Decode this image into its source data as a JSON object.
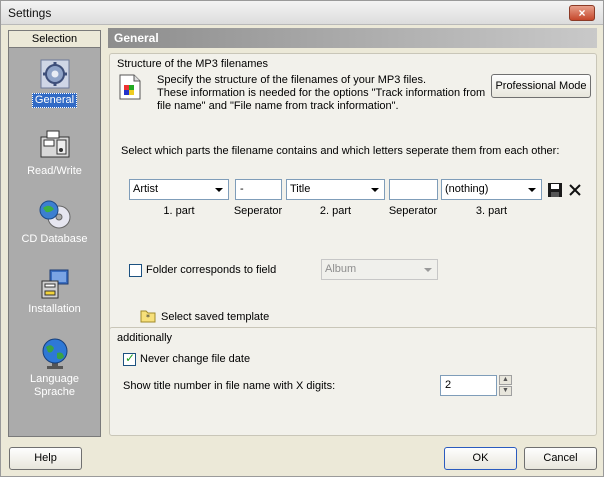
{
  "window": {
    "title": "Settings",
    "close_label": "×"
  },
  "sidebar": {
    "header": "Selection",
    "items": [
      {
        "label": "General",
        "icon": "gear-icon",
        "selected": true
      },
      {
        "label": "Read/Write",
        "icon": "read-write-icon"
      },
      {
        "label": "CD Database",
        "icon": "cd-icon"
      },
      {
        "label": "Installation",
        "icon": "installation-icon"
      },
      {
        "label": "Language",
        "label2": "Sprache",
        "icon": "globe-icon"
      }
    ]
  },
  "main": {
    "header": "General",
    "structure": {
      "title": "Structure of the MP3 filenames",
      "desc1": "Specify the structure of the filenames of your MP3 files.",
      "desc2": "These information is needed for the options \"Track information from",
      "desc3": "file name\" and \"File name from track information\".",
      "professional_button": "Professional Mode",
      "instruction": "Select which parts the filename contains and which letters seperate them from each other:",
      "part1_value": "Artist",
      "part1_caption": "1. part",
      "sep1_value": "-",
      "sep1_caption": "Seperator",
      "part2_value": "Title",
      "part2_caption": "2. part",
      "sep2_value": "",
      "sep2_caption": "Seperator",
      "part3_value": "(nothing)",
      "part3_caption": "3. part",
      "folder_label": "Folder corresponds to field",
      "folder_value": "Album",
      "template_label": "Select saved template"
    },
    "additionally": {
      "title": "additionally",
      "never_change_label": "Never change file date",
      "digits_label": "Show title number in file name with X digits:",
      "digits_value": "2"
    }
  },
  "footer": {
    "help": "Help",
    "ok": "OK",
    "cancel": "Cancel"
  },
  "colors": {
    "selection": "#316ac5",
    "sidebar_bg": "#ababab",
    "header_gradient": "#8d8d8d"
  }
}
